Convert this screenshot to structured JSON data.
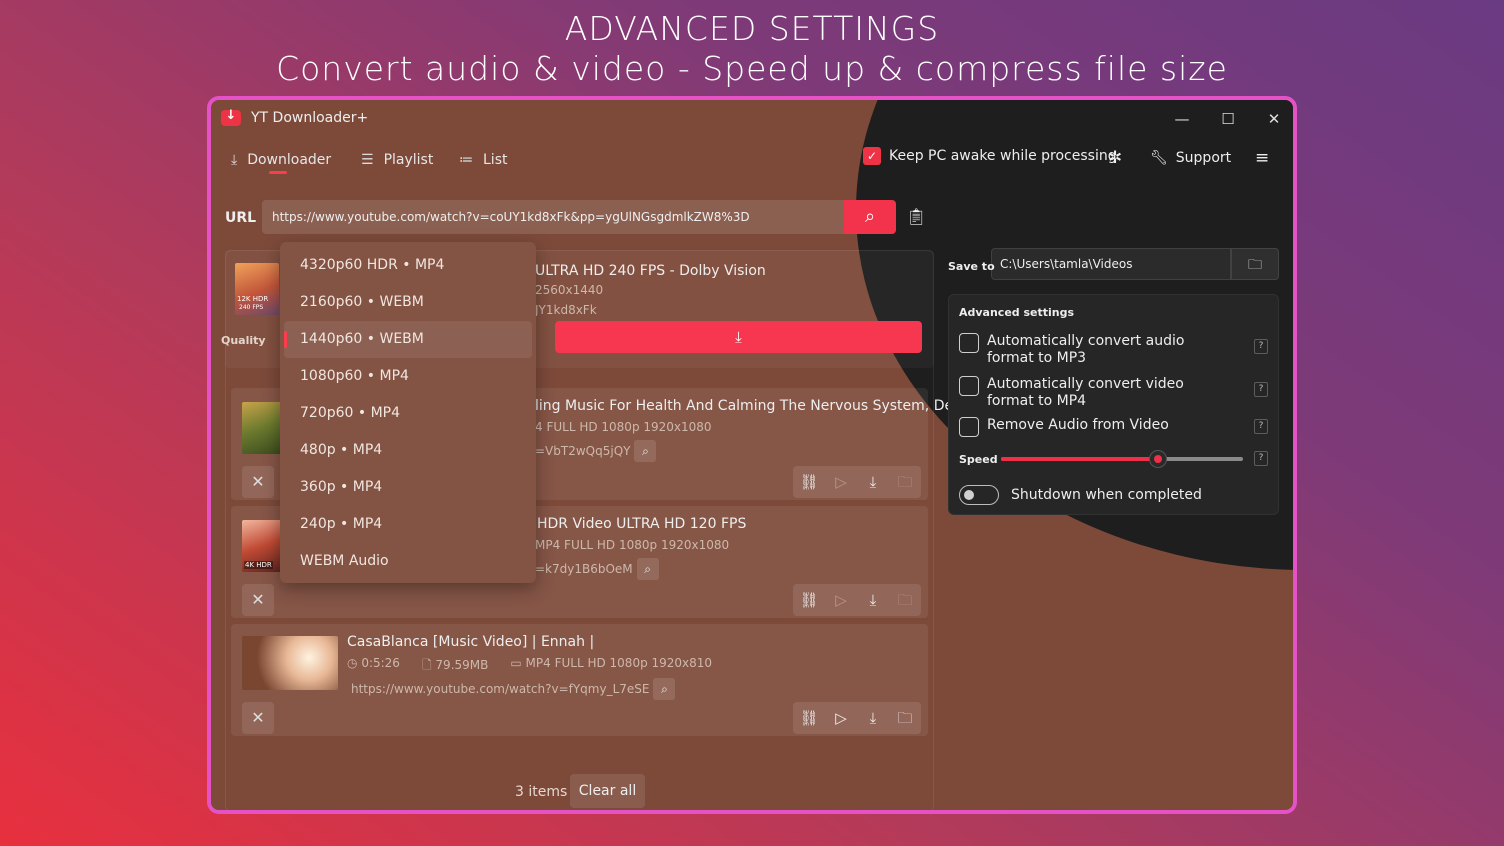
{
  "headline": {
    "line1": "ADVANCED SETTINGS",
    "line2": "Convert audio & video - Speed up & compress file size"
  },
  "app": {
    "title": "YT Downloader+",
    "controls": {
      "minimize": "—",
      "maximize": "☐",
      "close": "✕"
    }
  },
  "nav": {
    "downloader": "Downloader",
    "playlist": "Playlist",
    "list": "List",
    "keep_awake": "Keep PC awake while processing",
    "support": "Support"
  },
  "url": {
    "label": "URL",
    "value": "https://www.youtube.com/watch?v=coUY1kd8xFk&pp=ygUlNGsgdmlkZW8%3D"
  },
  "current": {
    "title_visible": "ULTRA HD 240 FPS - Dolby Vision",
    "resolution_visible": "2560x1440",
    "id_visible": "JY1kd8xFk",
    "quality_label": "Quality",
    "thumb_badge": "12K HDR",
    "thumb_badge2": "240 FPS"
  },
  "quality_options": [
    "4320p60 HDR • MP4",
    "2160p60 • WEBM",
    "1440p60 • WEBM",
    "1080p60 • MP4",
    "720p60 • MP4",
    "480p • MP4",
    "360p • MP4",
    "240p • MP4",
    "WEBM Audio"
  ],
  "quality_selected_index": 2,
  "items": [
    {
      "title_visible": "ling Music For Health And Calming The Nervous System, Deep",
      "meta_visible": "4 FULL HD 1080p 1920x1080",
      "url_visible": "=VbT2wQq5jQY"
    },
    {
      "title_visible": "HDR Video ULTRA HD 120 FPS",
      "meta_visible": "MP4 FULL HD 1080p 1920x1080",
      "url_visible": "=k7dy1B6bOeM",
      "thumb_badge": "4K HDR"
    },
    {
      "title": "CasaBlanca [Music Video] | Ennah |",
      "duration": "0:5:26",
      "size": "79.59MB",
      "format": "MP4 FULL HD 1080p 1920x810",
      "url": "https://www.youtube.com/watch?v=fYqmy_L7eSE"
    }
  ],
  "footer": {
    "count": "3 items",
    "clear": "Clear all"
  },
  "save_to": {
    "label": "Save to",
    "path": "C:\\Users\\tamla\\Videos"
  },
  "advanced": {
    "title": "Advanced settings",
    "opt_audio": "Automatically convert audio format to MP3",
    "opt_video": "Automatically convert video format to MP4",
    "opt_remove_audio": "Remove Audio from Video",
    "help": "?",
    "speed_label": "Speed",
    "speed_value": 0.65,
    "shutdown": "Shutdown when completed"
  },
  "colors": {
    "accent": "#f2334b",
    "frame": "#e552c8"
  }
}
